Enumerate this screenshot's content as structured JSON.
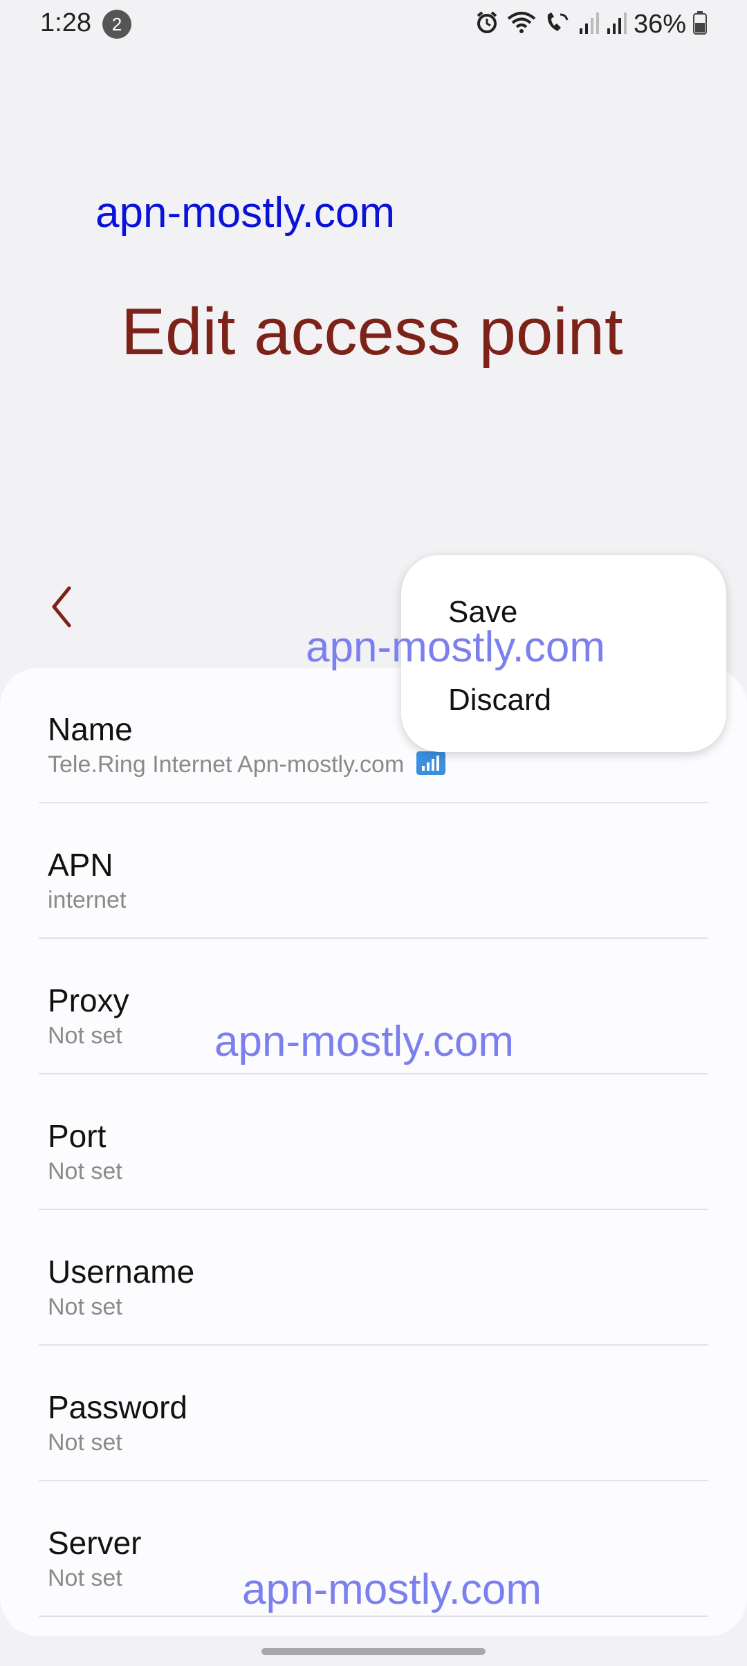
{
  "status_bar": {
    "time": "1:28",
    "notification_count": "2",
    "battery": "36%"
  },
  "watermarks": {
    "top": "apn-mostly.com",
    "popup": "apn-mostly.com",
    "middle": "apn-mostly.com",
    "bottom": "apn-mostly.com"
  },
  "header": {
    "title": "Edit access point"
  },
  "menu": {
    "save": "Save",
    "discard": "Discard"
  },
  "fields": [
    {
      "title": "Name",
      "value": "Tele.Ring Internet Apn-mostly.com"
    },
    {
      "title": "APN",
      "value": "internet"
    },
    {
      "title": "Proxy",
      "value": "Not set"
    },
    {
      "title": "Port",
      "value": "Not set"
    },
    {
      "title": "Username",
      "value": "Not set"
    },
    {
      "title": "Password",
      "value": "Not set"
    },
    {
      "title": "Server",
      "value": "Not set"
    }
  ],
  "colors": {
    "title": "#7c2219",
    "watermark": "#0a12d8",
    "watermark_light": "#7b80ee"
  },
  "icons": [
    "alarm-icon",
    "wifi-icon",
    "wifi-calling-icon",
    "signal-icon",
    "signal-icon",
    "battery-icon",
    "back-arrow-icon",
    "signal-bars-badge-icon"
  ]
}
